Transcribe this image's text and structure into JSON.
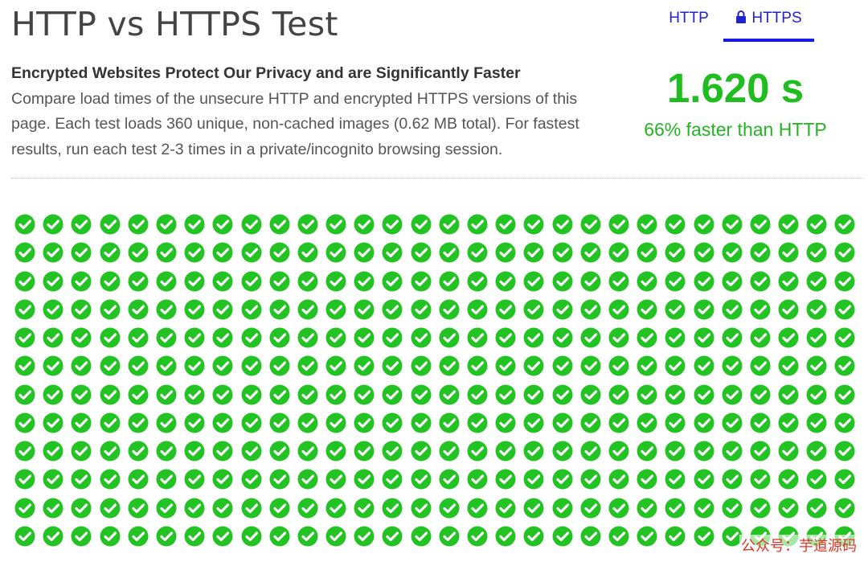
{
  "header": {
    "title": "HTTP vs HTTPS Test"
  },
  "tabs": [
    {
      "label": "HTTP",
      "active": false
    },
    {
      "label": "HTTPS",
      "active": true,
      "icon": "lock-icon"
    }
  ],
  "intro": {
    "headline": "Encrypted Websites Protect Our Privacy and are Significantly Faster",
    "body": "Compare load times of the unsecure HTTP and encrypted HTTPS versions of this page. Each test loads 360 unique, non-cached images (0.62 MB total). For fastest results, run each test 2-3 times in a private/incognito browsing session."
  },
  "result": {
    "time": "1.620 s",
    "comparison": "66% faster than HTTP"
  },
  "image_grid": {
    "columns": 30,
    "rows": 12,
    "count": 360,
    "status": "loaded",
    "icon": "check-circle-icon"
  },
  "watermark": "公众号：芋道源码",
  "colors": {
    "accent": "#1a1ae6",
    "success": "#22c322",
    "title": "#444444"
  }
}
